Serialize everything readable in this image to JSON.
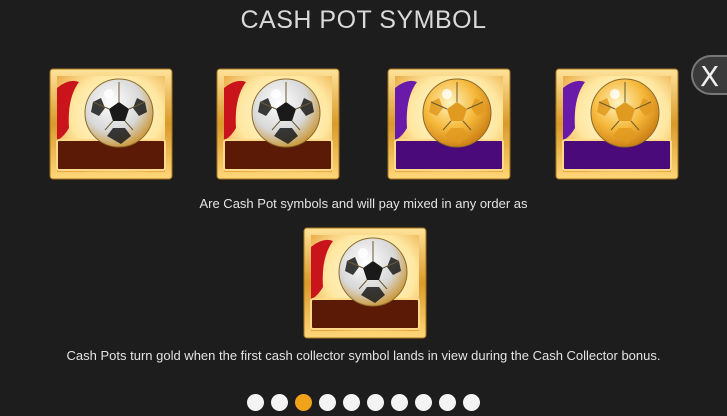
{
  "title": "CASH POT SYMBOL",
  "close_label": "X",
  "symbols_row": [
    {
      "variant": "red",
      "plate_color": "#5a1a06",
      "ball": "silver-gold"
    },
    {
      "variant": "red",
      "plate_color": "#5a1a06",
      "ball": "silver-gold"
    },
    {
      "variant": "purple",
      "plate_color": "#4a0a7a",
      "ball": "gold"
    },
    {
      "variant": "purple",
      "plate_color": "#4a0a7a",
      "ball": "gold"
    }
  ],
  "description_1": "Are Cash Pot symbols and will pay mixed in any order as",
  "gold_symbol": {
    "variant": "red",
    "plate_color": "#5a1a06",
    "ball": "silver-gold"
  },
  "description_2": "Cash Pots turn gold when the first cash collector symbol lands in view during the Cash Collector bonus.",
  "pagination": {
    "total": 10,
    "active_index": 2
  },
  "colors": {
    "frame_gold": "#e8b24a",
    "active_dot": "#f0a21b",
    "background": "#1d1d1d"
  }
}
